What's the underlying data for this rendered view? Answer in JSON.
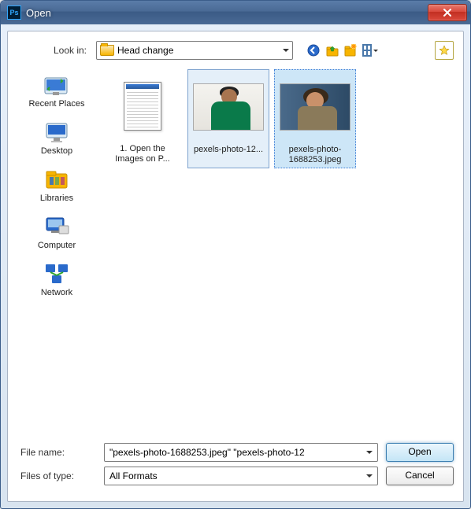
{
  "window": {
    "title": "Open",
    "app_icon_text": "Ps"
  },
  "topbar": {
    "lookin_label": "Look in:",
    "lookin_value": "Head change"
  },
  "sidebar": {
    "items": [
      {
        "label": "Recent Places"
      },
      {
        "label": "Desktop"
      },
      {
        "label": "Libraries"
      },
      {
        "label": "Computer"
      },
      {
        "label": "Network"
      }
    ]
  },
  "files": {
    "items": [
      {
        "name": "1. Open the Images on P..."
      },
      {
        "name": "pexels-photo-12..."
      },
      {
        "name": "pexels-photo-1688253.jpeg"
      }
    ]
  },
  "form": {
    "filename_label": "File name:",
    "filename_value": "\"pexels-photo-1688253.jpeg\" \"pexels-photo-12",
    "filetype_label": "Files of type:",
    "filetype_value": "All Formats",
    "open_label": "Open",
    "cancel_label": "Cancel"
  }
}
